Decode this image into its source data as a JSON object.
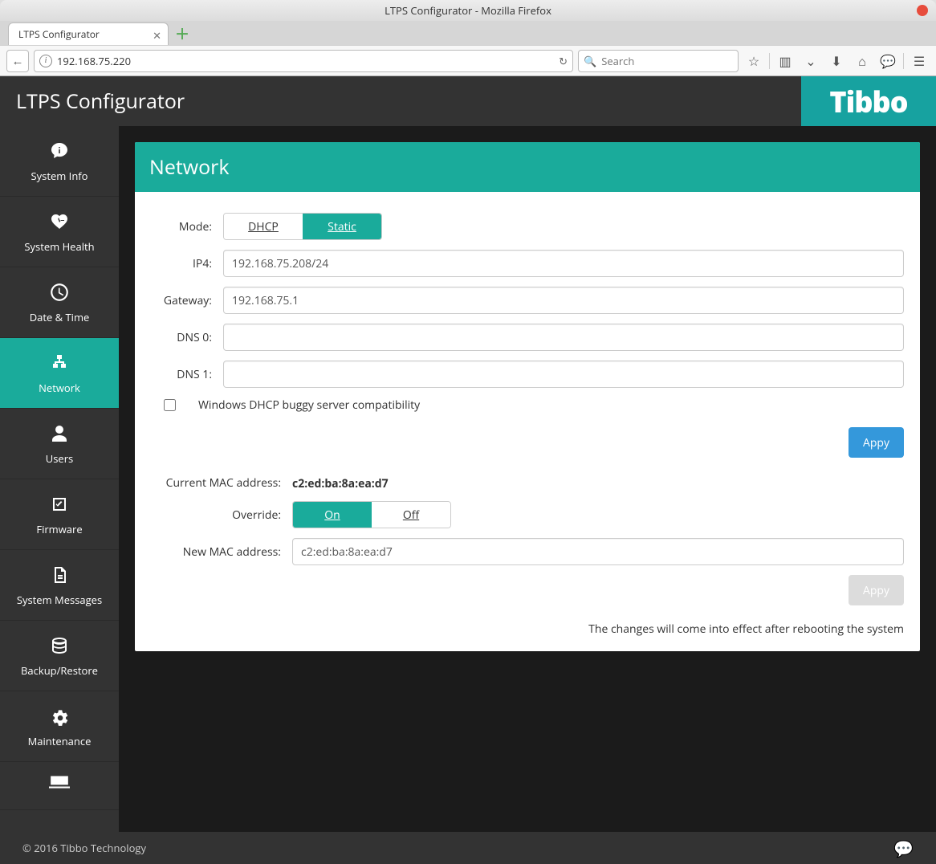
{
  "window": {
    "title": "LTPS Configurator - Mozilla Firefox",
    "tab_label": "LTPS Configurator"
  },
  "toolbar": {
    "url": "192.168.75.220",
    "search_placeholder": "Search"
  },
  "header": {
    "app_title": "LTPS Configurator",
    "brand": "Tibbo"
  },
  "sidebar": {
    "items": [
      {
        "label": "System Info"
      },
      {
        "label": "System Health"
      },
      {
        "label": "Date & Time"
      },
      {
        "label": "Network",
        "active": true
      },
      {
        "label": "Users"
      },
      {
        "label": "Firmware"
      },
      {
        "label": "System Messages"
      },
      {
        "label": "Backup/Restore"
      },
      {
        "label": "Maintenance"
      }
    ]
  },
  "panel": {
    "title": "Network",
    "mode_label": "Mode:",
    "mode_dhcp": "DHCP",
    "mode_static": "Static",
    "ip4_label": "IP4:",
    "ip4_value": "192.168.75.208/24",
    "gateway_label": "Gateway:",
    "gateway_value": "192.168.75.1",
    "dns0_label": "DNS 0:",
    "dns0_value": "",
    "dns1_label": "DNS 1:",
    "dns1_value": "",
    "dhcp_compat_label": "Windows DHCP buggy server compatibility",
    "apply_label": "Appy",
    "current_mac_label": "Current MAC address:",
    "current_mac_value": "c2:ed:ba:8a:ea:d7",
    "override_label": "Override:",
    "override_on": "On",
    "override_off": "Off",
    "new_mac_label": "New MAC address:",
    "new_mac_value": "c2:ed:ba:8a:ea:d7",
    "apply2_label": "Appy",
    "note": "The changes will come into effect after rebooting the system"
  },
  "footer": {
    "copyright": "© 2016 Tibbo Technology"
  }
}
